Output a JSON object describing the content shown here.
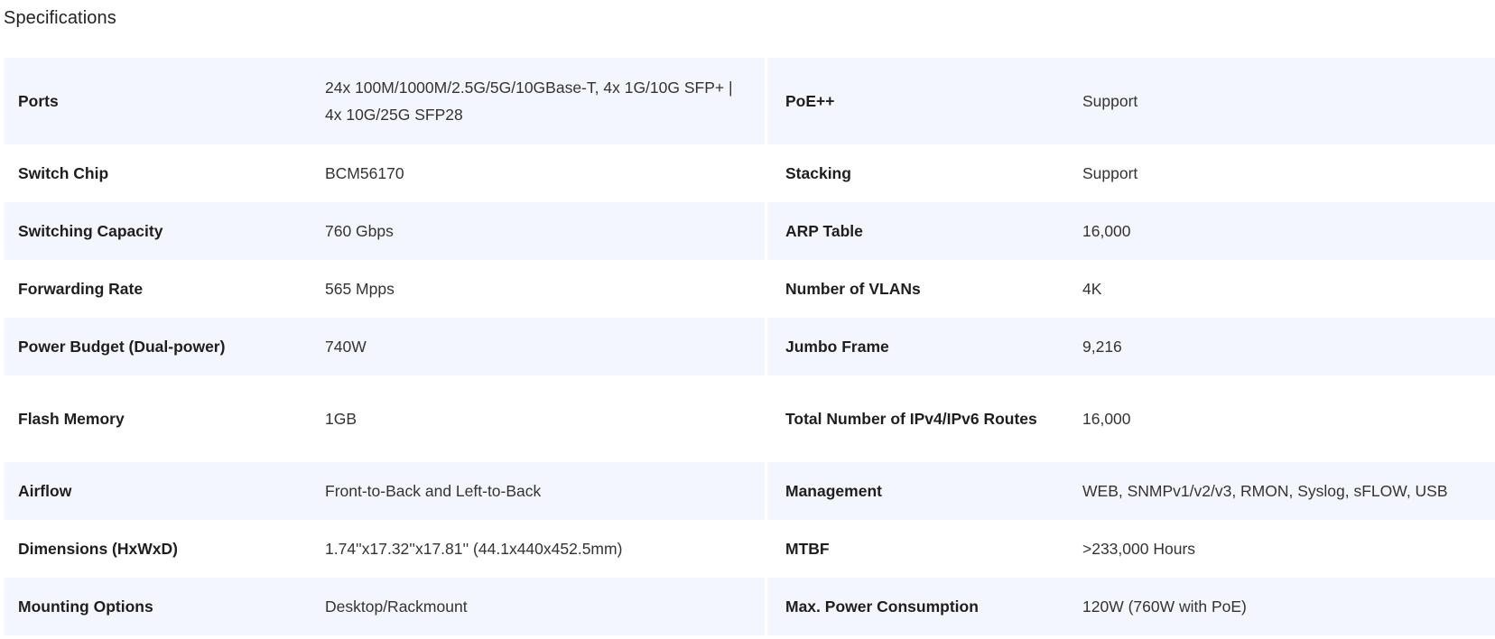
{
  "page": {
    "title": "Specifications"
  },
  "specs": {
    "rows": [
      {
        "left_label": "Ports",
        "left_value": "24x 100M/1000M/2.5G/5G/10GBase-T, 4x 1G/10G SFP+ | 4x 10G/25G SFP28",
        "right_label": "PoE++",
        "right_value": "Support"
      },
      {
        "left_label": "Switch Chip",
        "left_value": "BCM56170",
        "right_label": "Stacking",
        "right_value": "Support"
      },
      {
        "left_label": "Switching Capacity",
        "left_value": "760 Gbps",
        "right_label": "ARP Table",
        "right_value": "16,000"
      },
      {
        "left_label": "Forwarding Rate",
        "left_value": "565 Mpps",
        "right_label": "Number of VLANs",
        "right_value": "4K"
      },
      {
        "left_label": "Power Budget (Dual-power)",
        "left_value": "740W",
        "right_label": "Jumbo Frame",
        "right_value": "9,216"
      },
      {
        "left_label": "Flash Memory",
        "left_value": "1GB",
        "right_label": "Total Number of IPv4/IPv6 Routes",
        "right_value": "16,000"
      },
      {
        "left_label": "Airflow",
        "left_value": "Front-to-Back and Left-to-Back",
        "right_label": "Management",
        "right_value": "WEB, SNMPv1/v2/v3, RMON, Syslog, sFLOW, USB"
      },
      {
        "left_label": "Dimensions (HxWxD)",
        "left_value": "1.74''x17.32''x17.81'' (44.1x440x452.5mm)",
        "right_label": "MTBF",
        "right_value": ">233,000 Hours"
      },
      {
        "left_label": "Mounting Options",
        "left_value": "Desktop/Rackmount",
        "right_label": "Max. Power Consumption",
        "right_value": "120W (760W with PoE)"
      }
    ]
  }
}
